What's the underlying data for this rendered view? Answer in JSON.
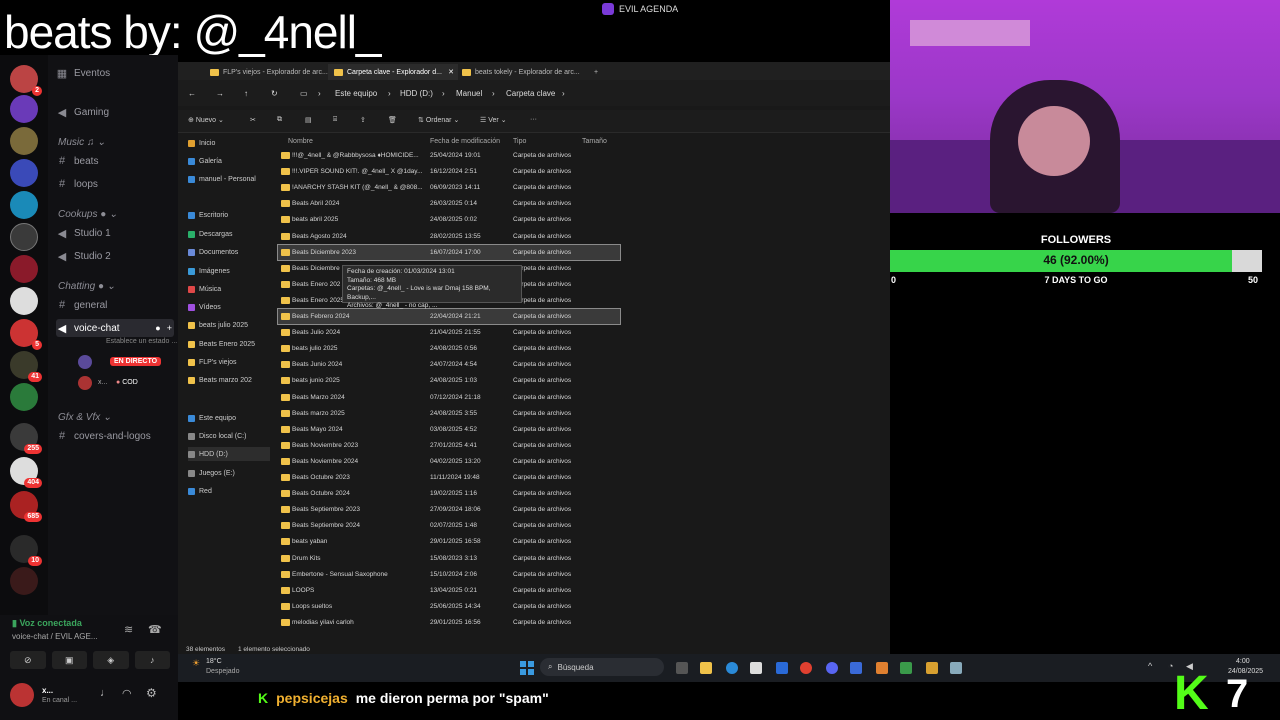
{
  "overlay_title": "beats by: @_4nell_",
  "server_name": "EVIL AGENDA",
  "rail_badges": [
    "2",
    "5",
    "41",
    "255",
    "404",
    "685",
    "10"
  ],
  "channels": {
    "top": [
      {
        "icon": "calendar-icon",
        "label": "Eventos"
      },
      {
        "icon": "speaker-icon",
        "label": "Gaming"
      }
    ],
    "cat_music": "Music",
    "music": [
      {
        "icon": "hash-icon",
        "label": "beats"
      },
      {
        "icon": "hash-icon",
        "label": "loops"
      }
    ],
    "cat_cookups": "Cookups",
    "cookups": [
      {
        "icon": "speaker-icon",
        "label": "Studio 1"
      },
      {
        "icon": "speaker-icon",
        "label": "Studio 2"
      }
    ],
    "cat_chatting": "Chatting",
    "chatting": [
      {
        "icon": "hash-icon",
        "label": "general"
      },
      {
        "icon": "speaker-icon",
        "label": "voice-chat"
      }
    ],
    "voice_status": "Establece un estado ...",
    "live_badge": "EN DIRECTO",
    "user_x": "x...",
    "user_game": "COD",
    "cat_gfx": "Gfx & Vfx",
    "gfx": [
      {
        "icon": "hash-icon",
        "label": "covers-and-logos"
      }
    ]
  },
  "voice_panel": {
    "status": "Voz conectada",
    "channel": "voice-chat / EVIL AGE...",
    "user": "x...",
    "user_sub": "En canal ..."
  },
  "explorer": {
    "tabs": [
      "FLP's viejos - Explorador de arc...",
      "Carpeta clave - Explorador d...",
      "beats tokely - Explorador de arc..."
    ],
    "breadcrumb": [
      "Este equipo",
      "HDD (D:)",
      "Manuel",
      "Carpeta clave"
    ],
    "commands": {
      "new": "Nuevo",
      "sort": "Ordenar",
      "view": "Ver"
    },
    "nav": [
      {
        "label": "Inicio",
        "color": "#e0a030"
      },
      {
        "label": "Galería",
        "color": "#3a8ad8"
      },
      {
        "label": "manuel - Personal",
        "color": "#3a8ad8"
      },
      {
        "label": "Escritorio",
        "color": "#3a8ad8"
      },
      {
        "label": "Descargas",
        "color": "#2ab06a"
      },
      {
        "label": "Documentos",
        "color": "#6a8ad8"
      },
      {
        "label": "Imágenes",
        "color": "#3a9ad8"
      },
      {
        "label": "Música",
        "color": "#e04848"
      },
      {
        "label": "Vídeos",
        "color": "#a050e0"
      },
      {
        "label": "beats julio 2025",
        "color": "#f0c24a"
      },
      {
        "label": "Beats Enero 2025",
        "color": "#f0c24a"
      },
      {
        "label": "FLP's viejos",
        "color": "#f0c24a"
      },
      {
        "label": "Beats marzo 202",
        "color": "#f0c24a"
      },
      {
        "label": "Este equipo",
        "color": "#3a8ad8"
      },
      {
        "label": "Disco local (C:)",
        "color": "#888"
      },
      {
        "label": "HDD (D:)",
        "color": "#888"
      },
      {
        "label": "Juegos (E:)",
        "color": "#888"
      },
      {
        "label": "Red",
        "color": "#3a8ad8"
      }
    ],
    "columns": {
      "name": "Nombre",
      "date": "Fecha de modificación",
      "type": "Tipo",
      "size": "Tamaño"
    },
    "rows": [
      {
        "name": "!!!@_4nell_ & @Rabbbysosa ♦HOMICIDE...",
        "date": "25/04/2024 19:01",
        "type": "Carpeta de archivos"
      },
      {
        "name": "!!!.VIPER SOUND KIT!. @_4nell_ X @1day...",
        "date": "16/12/2024 2:51",
        "type": "Carpeta de archivos"
      },
      {
        "name": "!ANARCHY STASH KIT (@_4nell_ & @808...",
        "date": "06/09/2023 14:11",
        "type": "Carpeta de archivos"
      },
      {
        "name": "Beats Abril 2024",
        "date": "26/03/2025 0:14",
        "type": "Carpeta de archivos"
      },
      {
        "name": "beats abril 2025",
        "date": "24/08/2025 0:02",
        "type": "Carpeta de archivos"
      },
      {
        "name": "Beats Agosto 2024",
        "date": "28/02/2025 13:55",
        "type": "Carpeta de archivos"
      },
      {
        "name": "Beats Diciembre 2023",
        "date": "16/07/2024 17:00",
        "type": "Carpeta de archivos"
      },
      {
        "name": "Beats Diciembre",
        "date": "",
        "type": "Carpeta de archivos"
      },
      {
        "name": "Beats Enero 202",
        "date": "",
        "type": "Carpeta de archivos"
      },
      {
        "name": "Beats Enero 2025",
        "date": "",
        "type": "Carpeta de archivos"
      },
      {
        "name": "Beats Febrero 2024",
        "date": "22/04/2024 21:21",
        "type": "Carpeta de archivos"
      },
      {
        "name": "Beats Julio 2024",
        "date": "21/04/2025 21:55",
        "type": "Carpeta de archivos"
      },
      {
        "name": "beats julio 2025",
        "date": "24/08/2025 0:56",
        "type": "Carpeta de archivos"
      },
      {
        "name": "Beats Junio 2024",
        "date": "24/07/2024 4:54",
        "type": "Carpeta de archivos"
      },
      {
        "name": "beats junio 2025",
        "date": "24/08/2025 1:03",
        "type": "Carpeta de archivos"
      },
      {
        "name": "Beats Marzo 2024",
        "date": "07/12/2024 21:18",
        "type": "Carpeta de archivos"
      },
      {
        "name": "Beats marzo 2025",
        "date": "24/08/2025 3:55",
        "type": "Carpeta de archivos"
      },
      {
        "name": "Beats Mayo 2024",
        "date": "03/08/2025 4:52",
        "type": "Carpeta de archivos"
      },
      {
        "name": "Beats Noviembre 2023",
        "date": "27/01/2025 4:41",
        "type": "Carpeta de archivos"
      },
      {
        "name": "Beats Noviembre 2024",
        "date": "04/02/2025 13:20",
        "type": "Carpeta de archivos"
      },
      {
        "name": "Beats Octubre 2023",
        "date": "11/11/2024 19:48",
        "type": "Carpeta de archivos"
      },
      {
        "name": "Beats Octubre 2024",
        "date": "19/02/2025 1:16",
        "type": "Carpeta de archivos"
      },
      {
        "name": "Beats Septiembre 2023",
        "date": "27/09/2024 18:06",
        "type": "Carpeta de archivos"
      },
      {
        "name": "Beats Septiembre 2024",
        "date": "02/07/2025 1:48",
        "type": "Carpeta de archivos"
      },
      {
        "name": "beats yaban",
        "date": "29/01/2025 16:58",
        "type": "Carpeta de archivos"
      },
      {
        "name": "Drum Kits",
        "date": "15/08/2023 3:13",
        "type": "Carpeta de archivos"
      },
      {
        "name": "Embertone - Sensual Saxophone",
        "date": "15/10/2024 2:06",
        "type": "Carpeta de archivos"
      },
      {
        "name": "LOOPS",
        "date": "13/04/2025 0:21",
        "type": "Carpeta de archivos"
      },
      {
        "name": "Loops sueltos",
        "date": "25/06/2025 14:34",
        "type": "Carpeta de archivos"
      },
      {
        "name": "melodias yilavi carloh",
        "date": "29/01/2025 16:56",
        "type": "Carpeta de archivos"
      }
    ],
    "selected_rows": [
      6,
      10
    ],
    "tooltip": [
      "Fecha de creación: 01/03/2024 13:01",
      "Tamaño: 468 MB",
      "Carpetas: @_4nell_ - Love is war Dmaj 158 BPM, Backup,...",
      "Archivos: @_4nell_ - no cap, ..."
    ],
    "status": {
      "count": "38 elementos",
      "selected": "1 elemento seleccionado"
    }
  },
  "taskbar": {
    "weather_temp": "18°C",
    "weather_desc": "Despejado",
    "search": "Búsqueda",
    "time": "4:00",
    "date": "24/08/2025"
  },
  "followers": {
    "title": "FOLLOWERS",
    "value_text": "46 (92.00%)",
    "progress": 0.92,
    "min": "0",
    "max": "50",
    "days_left": "7 DAYS TO GO"
  },
  "chat": {
    "user": "pepsicejas",
    "message": "me dieron perma por \"spam\"",
    "accent": "#53fc18"
  },
  "kick_count": "7"
}
